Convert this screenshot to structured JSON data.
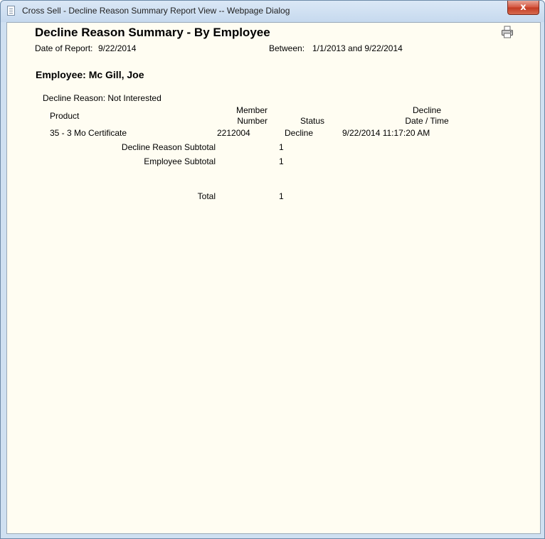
{
  "window": {
    "title": "Cross Sell - Decline Reason Summary Report View -- Webpage Dialog",
    "close_glyph": "x"
  },
  "report": {
    "title": "Decline Reason Summary - By Employee",
    "date_label": "Date of Report:",
    "date_value": "9/22/2014",
    "between_label": "Between:",
    "between_value": "1/1/2013 and 9/22/2014",
    "employee_label": "Employee: Mc Gill, Joe",
    "decline_reason_label": "Decline Reason: Not Interested",
    "columns": {
      "product": "Product",
      "member_line1": "Member",
      "member_line2": "Number",
      "status": "Status",
      "decline_line1": "Decline",
      "decline_line2": "Date / Time"
    },
    "rows": [
      {
        "product": "35 - 3 Mo Certificate",
        "member_number": "2212004",
        "status": "Decline",
        "decline_datetime": "9/22/2014 11:17:20 AM"
      }
    ],
    "decline_reason_subtotal_label": "Decline Reason Subtotal",
    "decline_reason_subtotal_value": "1",
    "employee_subtotal_label": "Employee Subtotal",
    "employee_subtotal_value": "1",
    "total_label": "Total",
    "total_value": "1"
  },
  "icons": {
    "document": "document-icon",
    "printer": "printer-icon",
    "close": "close-icon"
  },
  "colors": {
    "report_background": "#fffdf2",
    "close_button": "#c23b22",
    "titlebar": "#cfe0f1"
  }
}
